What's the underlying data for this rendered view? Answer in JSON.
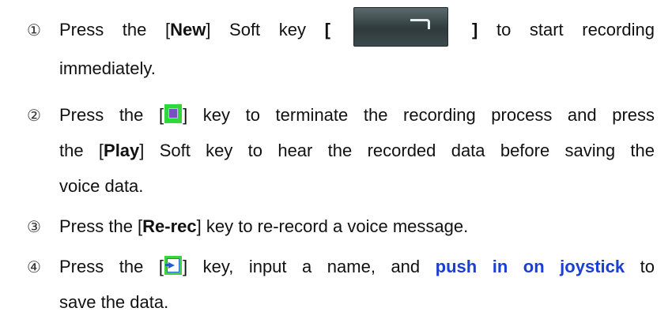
{
  "steps": [
    {
      "num": "①",
      "pre": "Press the [",
      "bold": "New",
      "mid": "] Soft key",
      "bracket_open": "[",
      "bracket_close": "]",
      "post": "to start recording",
      "cont": "immediately.",
      "icon": "soft-key-image"
    },
    {
      "num": "②",
      "pre": "Press the [",
      "close": "] key to terminate the recording process and press",
      "line2_pre": "the [",
      "line2_bold": "Play",
      "line2_post": "] Soft key to hear the recorded data before saving the",
      "line3": "voice data.",
      "icon": "stop-key-icon"
    },
    {
      "num": "③",
      "pre": "Press the [",
      "bold": "Re-rec",
      "post": "] key to re-record a voice message."
    },
    {
      "num": "④",
      "pre": "Press the [",
      "mid": "] key, input a name, and",
      "highlight": "push in on joystick",
      "post": "to",
      "cont": "save the data.",
      "icon": "save-key-icon"
    }
  ],
  "colors": {
    "text": "#111111",
    "highlight": "#1a3fd6",
    "key_green": "#2fd83a"
  }
}
